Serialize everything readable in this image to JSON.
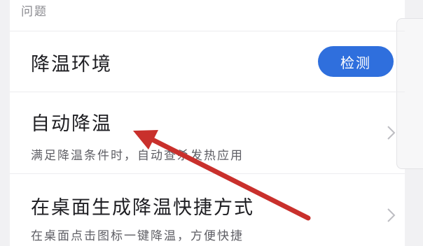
{
  "section": {
    "header": "问题"
  },
  "rows": [
    {
      "title": "降温环境",
      "button_label": "检测"
    },
    {
      "title": "自动降温",
      "description": "满足降温条件时，自动查杀发热应用"
    },
    {
      "title": "在桌面生成降温快捷方式",
      "description": "在桌面点击图标一键降温，方便快捷"
    }
  ],
  "icons": {
    "row_chevron": "chevron-right-icon",
    "annotation": "red-arrow-annotation"
  },
  "colors": {
    "accent": "#2f6fdd",
    "annotation": "#c9302c"
  }
}
